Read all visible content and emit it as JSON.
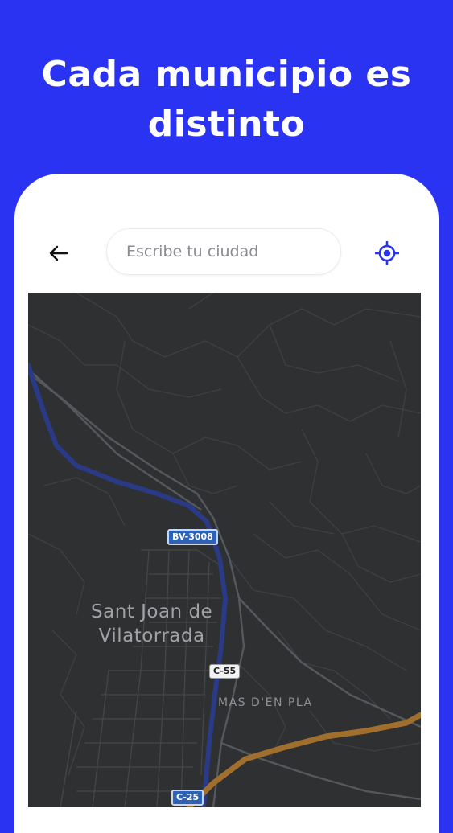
{
  "headline": {
    "line1": "Cada municipio es",
    "line2": "distinto"
  },
  "toolbar": {
    "back_icon": "arrow-left-icon",
    "search_placeholder": "Escribe tu ciudad",
    "locate_icon": "crosshair-location-icon"
  },
  "map": {
    "town_line1": "Sant Joan de",
    "town_line2": "Vilatorrada",
    "area_label": "MAS D'EN PLA",
    "road_bv": "BV-3008",
    "road_c55": "C-55",
    "road_c25": "C-25"
  },
  "colors": {
    "background": "#2a33f2",
    "map_background": "#2f3032",
    "river": "#2b3a86",
    "highway": "#a06f2e",
    "accent": "#2a33f2"
  }
}
